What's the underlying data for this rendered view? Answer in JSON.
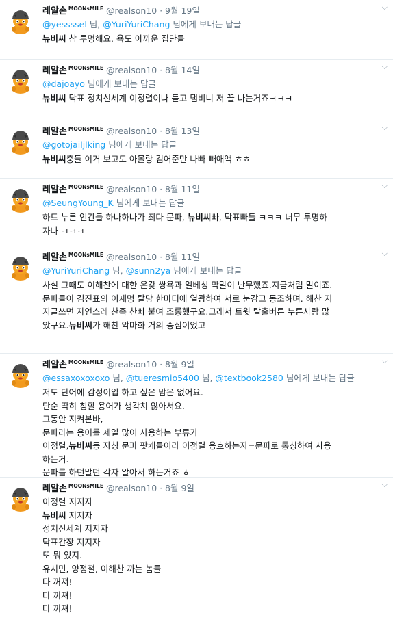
{
  "user": {
    "name": "레알손",
    "badge": "MOONsMILE",
    "handle": "@realson10",
    "separator": "·"
  },
  "common": {
    "reply_suffix_single": " 님에게 보내는 답글",
    "comma": ", ",
    "nim_comma": " 님, "
  },
  "tweets": [
    {
      "time": "9월 19일",
      "mentions": [
        "@yessssel",
        "@YuriYuriChang"
      ],
      "reply_mid": " 님, ",
      "reply_tail": " 님에게 보내는 답글",
      "lines": [
        {
          "bold": "뉴비씨",
          "text": "  참 투명해요. 욕도 아까운 집단들"
        }
      ]
    },
    {
      "time": "8월 14일",
      "mentions": [
        "@dajoayo"
      ],
      "reply_tail": " 님에게 보내는 답글",
      "lines": [
        {
          "bold": "뉴비씨",
          "text": " 닥표 정치신세계 이정렬이나 듣고 댐비니 저 꼴 나는거죠ㅋㅋㅋ"
        }
      ]
    },
    {
      "time": "8월 13일",
      "mentions": [
        "@gotojailjlking"
      ],
      "reply_tail": " 님에게 보내는 답글",
      "lines": [
        {
          "bold": "뉴비씨",
          "text": "충들 이거 보고도 아몰랑 김어준만 나빠 빼애액 ㅎㅎ"
        }
      ]
    },
    {
      "time": "8월 11일",
      "mentions": [
        "@SeungYoung_K"
      ],
      "reply_tail": " 님에게 보내는 답글",
      "lines": [
        {
          "pre": "하트 누른 인간들 하나하나가 죄다 문파, ",
          "bold": "뉴비씨",
          "text": "빠, 닥표빠들 ㅋㅋㅋ 너무 투명하"
        },
        {
          "text": "자나 ㅋㅋㅋ"
        }
      ]
    },
    {
      "time": "8월 11일",
      "mentions": [
        "@YuriYuriChang",
        "@sunn2ya"
      ],
      "reply_mid": " 님, ",
      "reply_tail": " 님에게 보내는 답글",
      "lines": [
        {
          "text": "사실 그때도 이해찬에 대한 온갖 쌍욕과 일베성 막말이 난무했죠.지금처럼 말이죠."
        },
        {
          "text": "문파들이 김진표의 이재명 탈당 한마디에 열광하여 서로 눈감고 동조하며. 해찬 지"
        },
        {
          "text": "지글쓰면 자연스레 찬족 찬빠 붙여 조롱했구요.그래서 트윗 탈출버튼 누른사람 많"
        },
        {
          "pre": "았구요.",
          "bold": "뉴비씨",
          "text": "가 해찬 악마화 거의 중심이었고"
        }
      ]
    },
    {
      "time": "8월 9일",
      "mentions": [
        "@essaxoxoxoxo",
        "@tueresmio5400",
        "@textbook2580"
      ],
      "reply_mid": " 님, ",
      "reply_tail": " 님에게 보내는 답글",
      "lines": [
        {
          "text": "저도 단어에 감정이입 하고 싶은 맘은 없어요."
        },
        {
          "text": "단순 딱히 칭할 용어가 생각치 않아서요."
        },
        {
          "text": "그동안 지켜본바,"
        },
        {
          "text": "문파라는 용어를 제일 많이 사용하는 부류가"
        },
        {
          "pre": "이정렬,",
          "bold": "뉴비씨",
          "text": "등 자칭 문파 팟캐들이라 이정렬 옹호하는자=문파로 통칭하여 사용"
        },
        {
          "text": "하는거."
        },
        {
          "text": "문파를 하던말던 각자 알아서 하는거죠 ㅎ"
        }
      ]
    },
    {
      "time": "8월 9일",
      "mentions": [],
      "lines": [
        {
          "text": "이정렬 지지자"
        },
        {
          "bold": "뉴비씨",
          "text": " 지지자"
        },
        {
          "text": "정치신세계 지지자"
        },
        {
          "text": "닥표간장 지지자"
        },
        {
          "text": "또 뭐 있지."
        },
        {
          "text": "유시민, 양정철, 이해찬 까는 놈들"
        },
        {
          "text": "다 꺼져!"
        },
        {
          "text": "다 꺼져!"
        },
        {
          "text": "다 꺼져!"
        }
      ]
    }
  ],
  "icons": {
    "avatar": "toothless-character-avatar-icon",
    "caret": "chevron-down-icon"
  },
  "colors": {
    "link": "#1da1f2",
    "muted": "#657786",
    "text": "#14171a",
    "divider": "#e6ecf0"
  }
}
